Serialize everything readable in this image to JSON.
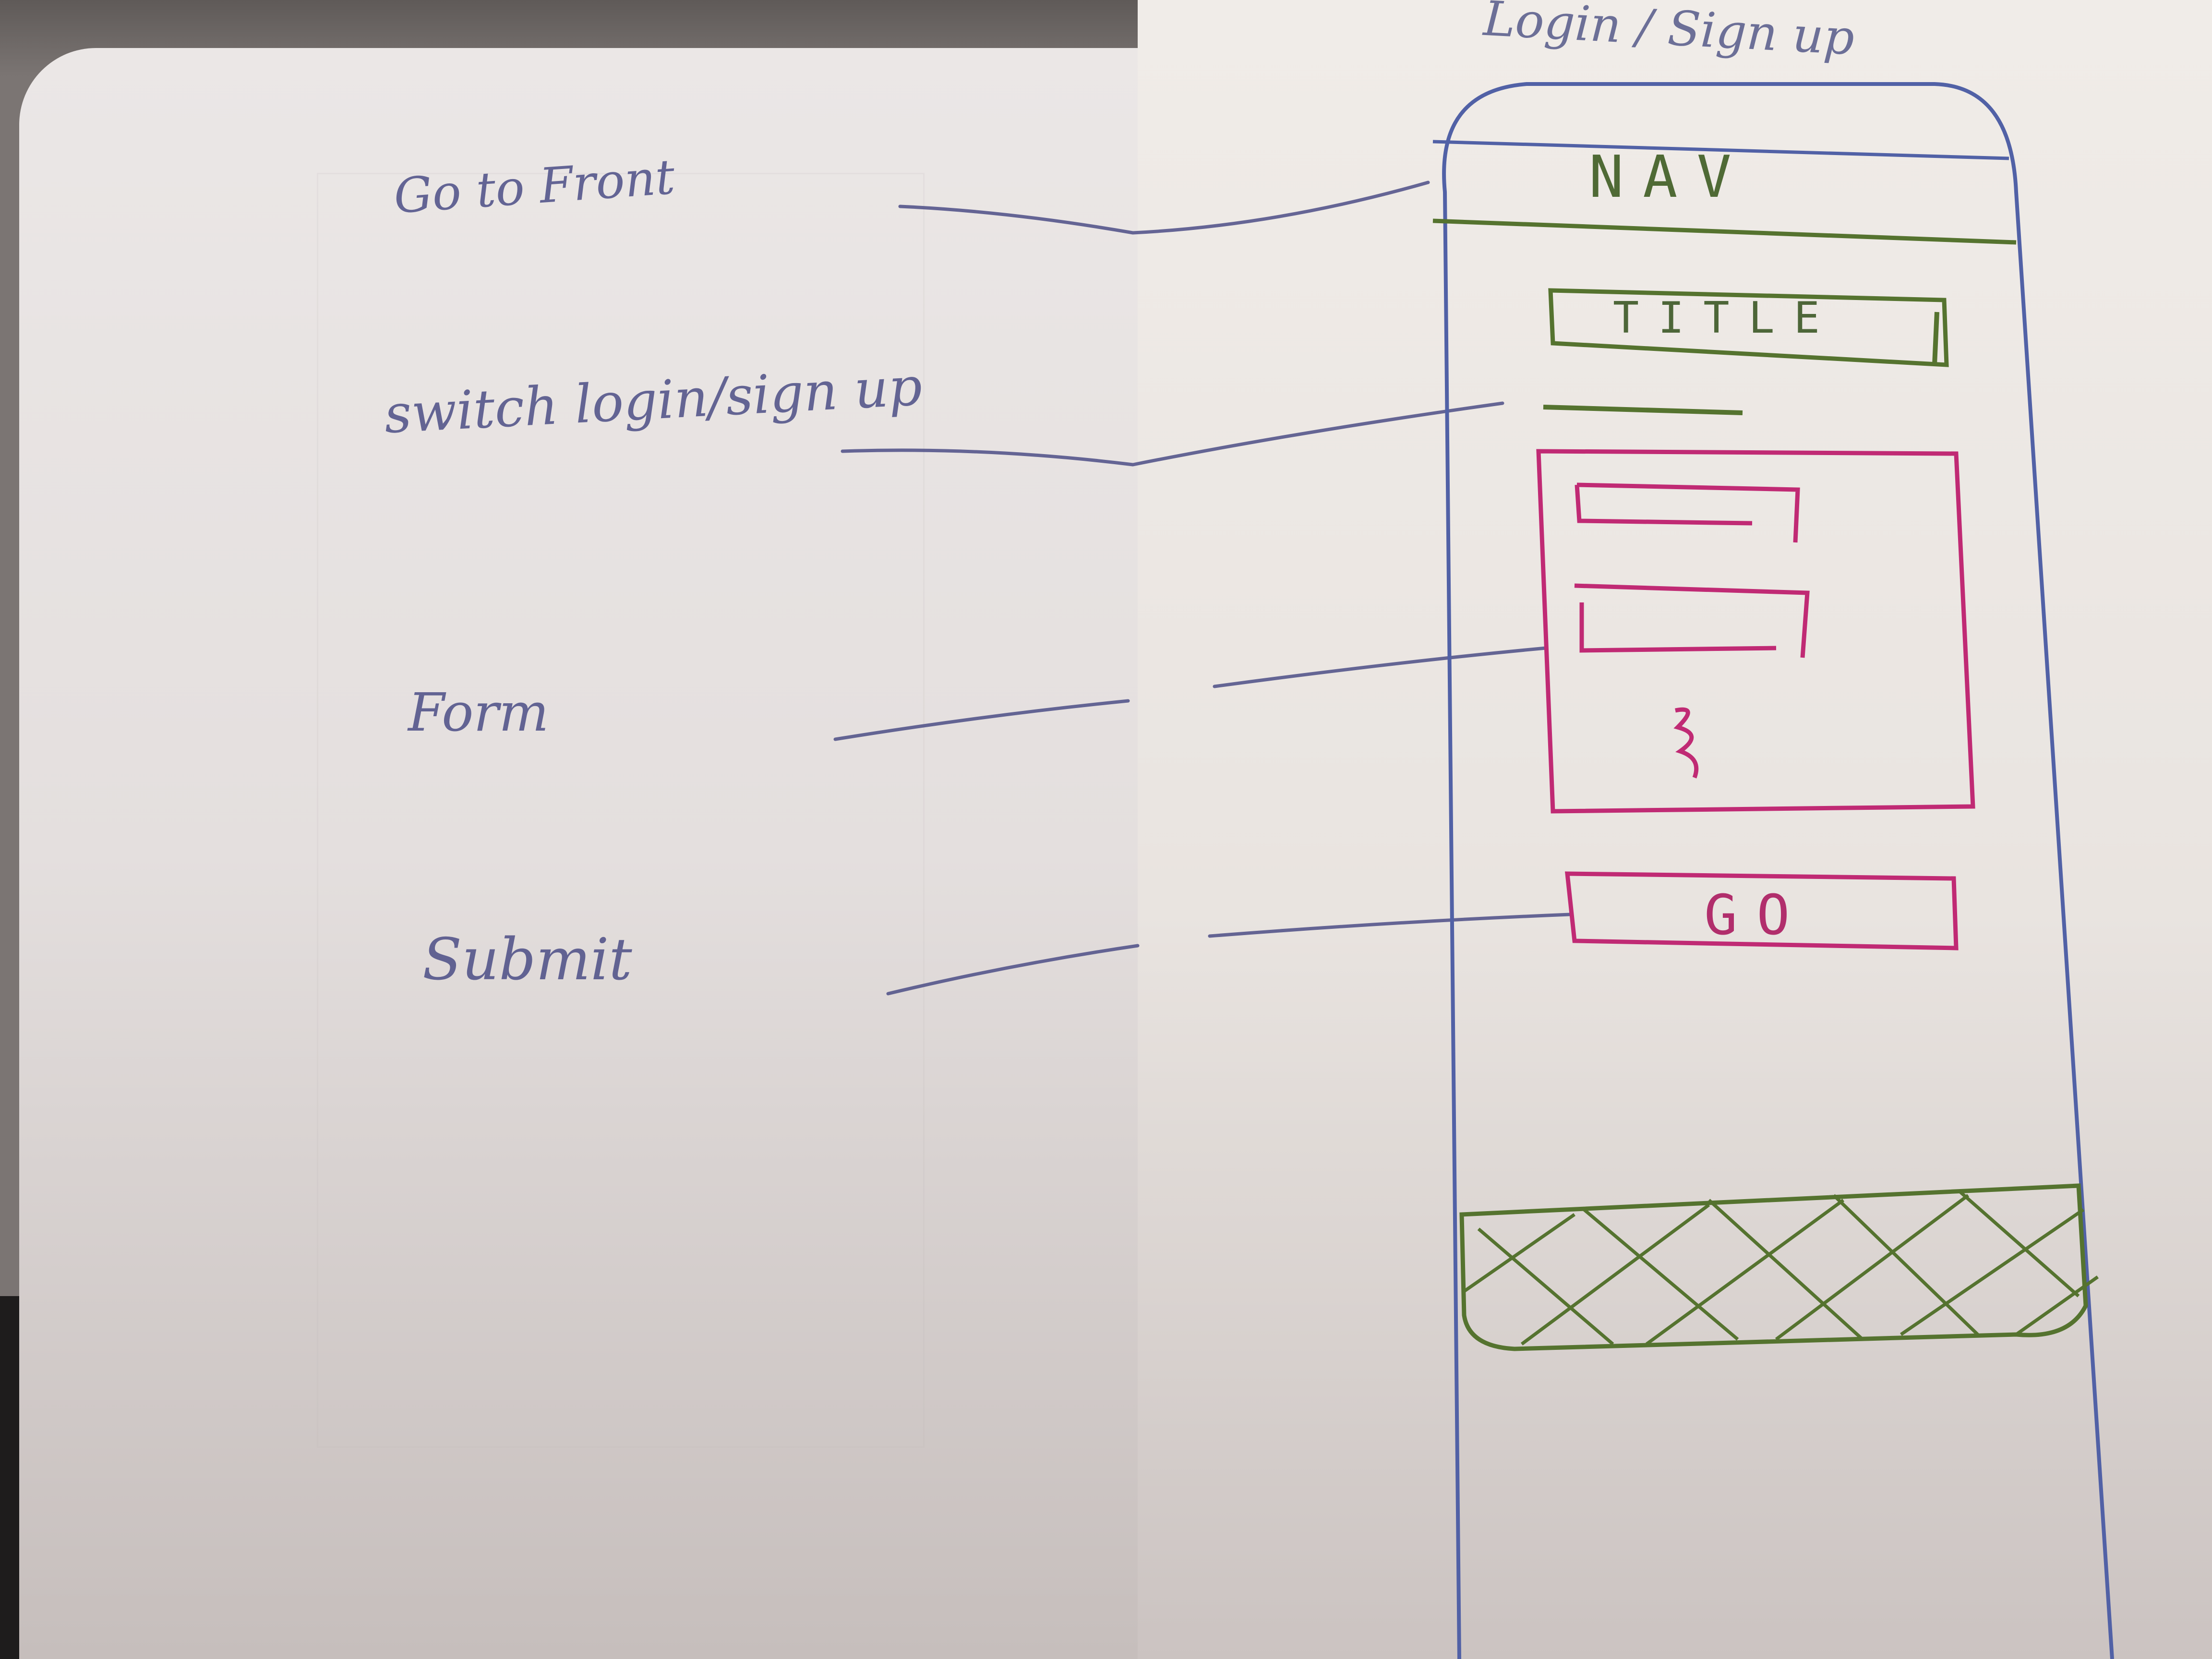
{
  "annotations": {
    "go_to_front": "Go to Front",
    "switch_login": "switch login/sign up",
    "form": "Form",
    "submit": "Submit"
  },
  "screen": {
    "heading": "Login / Sign up",
    "nav": "NAV",
    "title": "TITLE",
    "go_button": "GO"
  },
  "colors": {
    "pencil_blue": "#4c4e86",
    "green": "#55732f",
    "pink": "#c02a74"
  }
}
